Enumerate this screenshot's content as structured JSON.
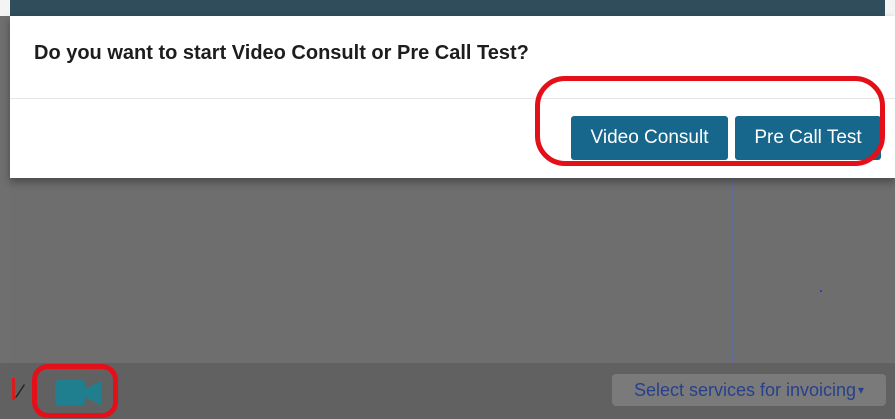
{
  "top_strip": {
    "left_text": " ",
    "right_text": " "
  },
  "modal": {
    "title": "Do you want to start Video Consult or Pre Call Test?",
    "buttons": {
      "video_consult": "Video Consult",
      "pre_call_test": "Pre Call Test"
    }
  },
  "footer": {
    "select_services_label": "Select services for invoicing",
    "select_caret": "▾"
  },
  "icons": {
    "video": "video-camera-icon",
    "pencil": "pencil-icon"
  },
  "colors": {
    "primary_button": "#17678c",
    "highlight_red": "#e3101a",
    "overlay_gray": "#6f6f6f",
    "select_text": "#27408b",
    "video_icon": "#1f7f8e"
  }
}
